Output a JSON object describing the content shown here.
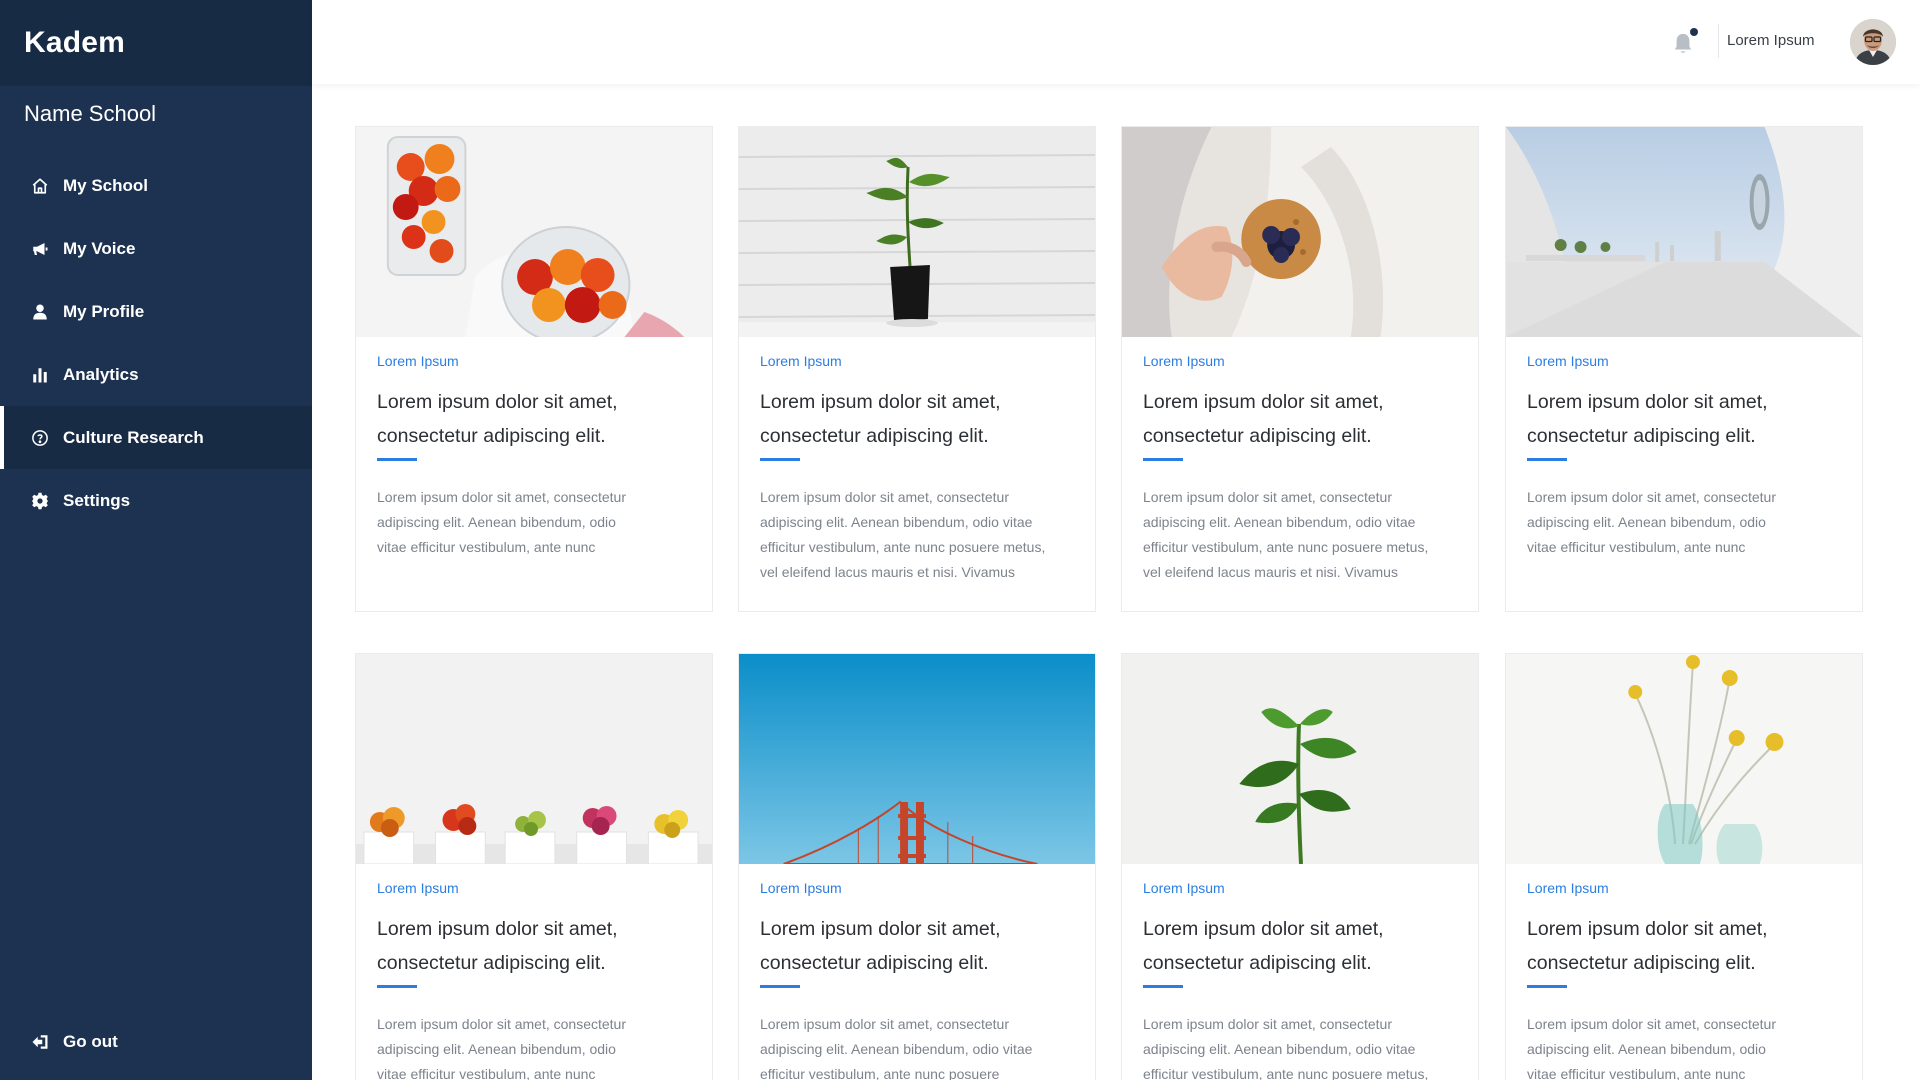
{
  "app": {
    "brand": "Kadem",
    "school": "Name School"
  },
  "sidebar": {
    "items": [
      {
        "label": "My School",
        "icon": "home-icon"
      },
      {
        "label": "My Voice",
        "icon": "megaphone-icon"
      },
      {
        "label": "My Profile",
        "icon": "user-icon"
      },
      {
        "label": "Analytics",
        "icon": "bar-chart-icon"
      },
      {
        "label": "Culture Research",
        "icon": "help-circle-icon",
        "active": true
      },
      {
        "label": "Settings",
        "icon": "gear-icon"
      }
    ],
    "go_out": {
      "label": "Go out",
      "icon": "logout-icon"
    }
  },
  "header": {
    "user_name": "Lorem Ipsum",
    "notification_icon": "bell-icon"
  },
  "colors": {
    "sidebar": "#1d3250",
    "accent": "#2b7de0"
  },
  "cards": [
    {
      "category": "Lorem Ipsum",
      "title_line1": "Lorem ipsum dolor sit amet,",
      "title_line2": "consectetur adipiscing elit.",
      "desc_lines": [
        "Lorem ipsum dolor sit amet, consectetur",
        "adipiscing elit. Aenean bibendum, odio",
        "vitae efficitur vestibulum, ante nunc"
      ],
      "image": "tomatoes in glasses"
    },
    {
      "category": "Lorem Ipsum",
      "title_line1": "Lorem ipsum dolor sit amet,",
      "title_line2": " consectetur adipiscing elit.",
      "desc_lines": [
        "Lorem ipsum dolor sit amet, consectetur",
        "adipiscing elit. Aenean bibendum, odio vitae",
        "efficitur vestibulum, ante nunc posuere metus,",
        "vel eleifend lacus mauris et nisi. Vivamus"
      ],
      "image": "potted plant"
    },
    {
      "category": "Lorem Ipsum",
      "title_line1": "Lorem ipsum dolor sit amet,",
      "title_line2": " consectetur adipiscing elit.",
      "desc_lines": [
        "Lorem ipsum dolor sit amet, consectetur",
        "adipiscing elit. Aenean bibendum, odio vitae",
        "efficitur vestibulum, ante nunc posuere metus,",
        "vel eleifend lacus mauris et nisi. Vivamus"
      ],
      "image": "hand holding muffin"
    },
    {
      "category": "Lorem Ipsum",
      "title_line1": "Lorem ipsum dolor sit amet,",
      "title_line2": " consectetur adipiscing elit.",
      "desc_lines": [
        "Lorem ipsum dolor sit amet, consectetur",
        "adipiscing elit. Aenean bibendum, odio",
        "vitae efficitur vestibulum, ante nunc"
      ],
      "image": "white architecture"
    },
    {
      "category": "Lorem Ipsum",
      "title_line1": "Lorem ipsum dolor sit amet,",
      "title_line2": " consectetur adipiscing elit.",
      "desc_lines": [
        "Lorem ipsum dolor sit amet, consectetur",
        "adipiscing elit. Aenean bibendum, odio",
        "vitae efficitur vestibulum, ante nunc"
      ],
      "image": "cacti in pots"
    },
    {
      "category": "Lorem Ipsum",
      "title_line1": "Lorem ipsum dolor sit amet,",
      "title_line2": " consectetur adipiscing elit.",
      "desc_lines": [
        "Lorem ipsum dolor sit amet, consectetur",
        "adipiscing elit. Aenean bibendum, odio vitae",
        "efficitur vestibulum, ante nunc posuere"
      ],
      "image": "golden gate bridge"
    },
    {
      "category": "Lorem Ipsum",
      "title_line1": "Lorem ipsum dolor sit amet,",
      "title_line2": " consectetur adipiscing elit.",
      "desc_lines": [
        "Lorem ipsum dolor sit amet, consectetur",
        "adipiscing elit. Aenean bibendum, odio vitae",
        "efficitur vestibulum, ante nunc posuere metus,"
      ],
      "image": "green plant"
    },
    {
      "category": "Lorem Ipsum",
      "title_line1": "Lorem ipsum dolor sit amet,",
      "title_line2": " consectetur adipiscing elit.",
      "desc_lines": [
        "Lorem ipsum dolor sit amet, consectetur",
        "adipiscing elit. Aenean bibendum, odio",
        "vitae efficitur vestibulum, ante nunc"
      ],
      "image": "yellow flowers in vases"
    }
  ]
}
